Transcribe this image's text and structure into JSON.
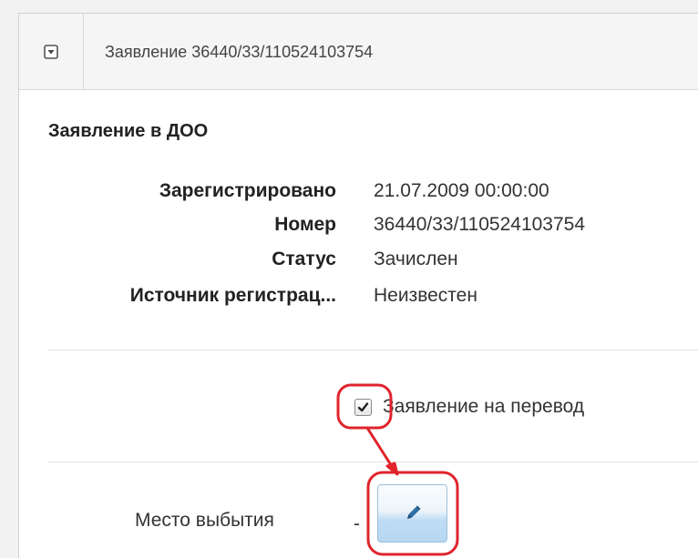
{
  "header": {
    "title": "Заявление 36440/33/110524103754",
    "collapse_icon": "collapse-toggle-icon"
  },
  "section": {
    "title": "Заявление в ДОО"
  },
  "fields": [
    {
      "label": "Зарегистрировано",
      "value": "21.07.2009 00:00:00"
    },
    {
      "label": "Номер",
      "value": "36440/33/110524103754"
    },
    {
      "label": "Статус",
      "value": "Зачислен"
    },
    {
      "label": "Источник регистрац...",
      "value": "Неизвестен"
    }
  ],
  "transfer": {
    "label": "Заявление на перевод",
    "checked": true
  },
  "departure": {
    "label": "Место выбытия",
    "value": "-",
    "edit_icon": "pencil-icon"
  },
  "annotation": {
    "color": "#e0242c",
    "arrow_icon": "arrow-down-right-icon"
  }
}
